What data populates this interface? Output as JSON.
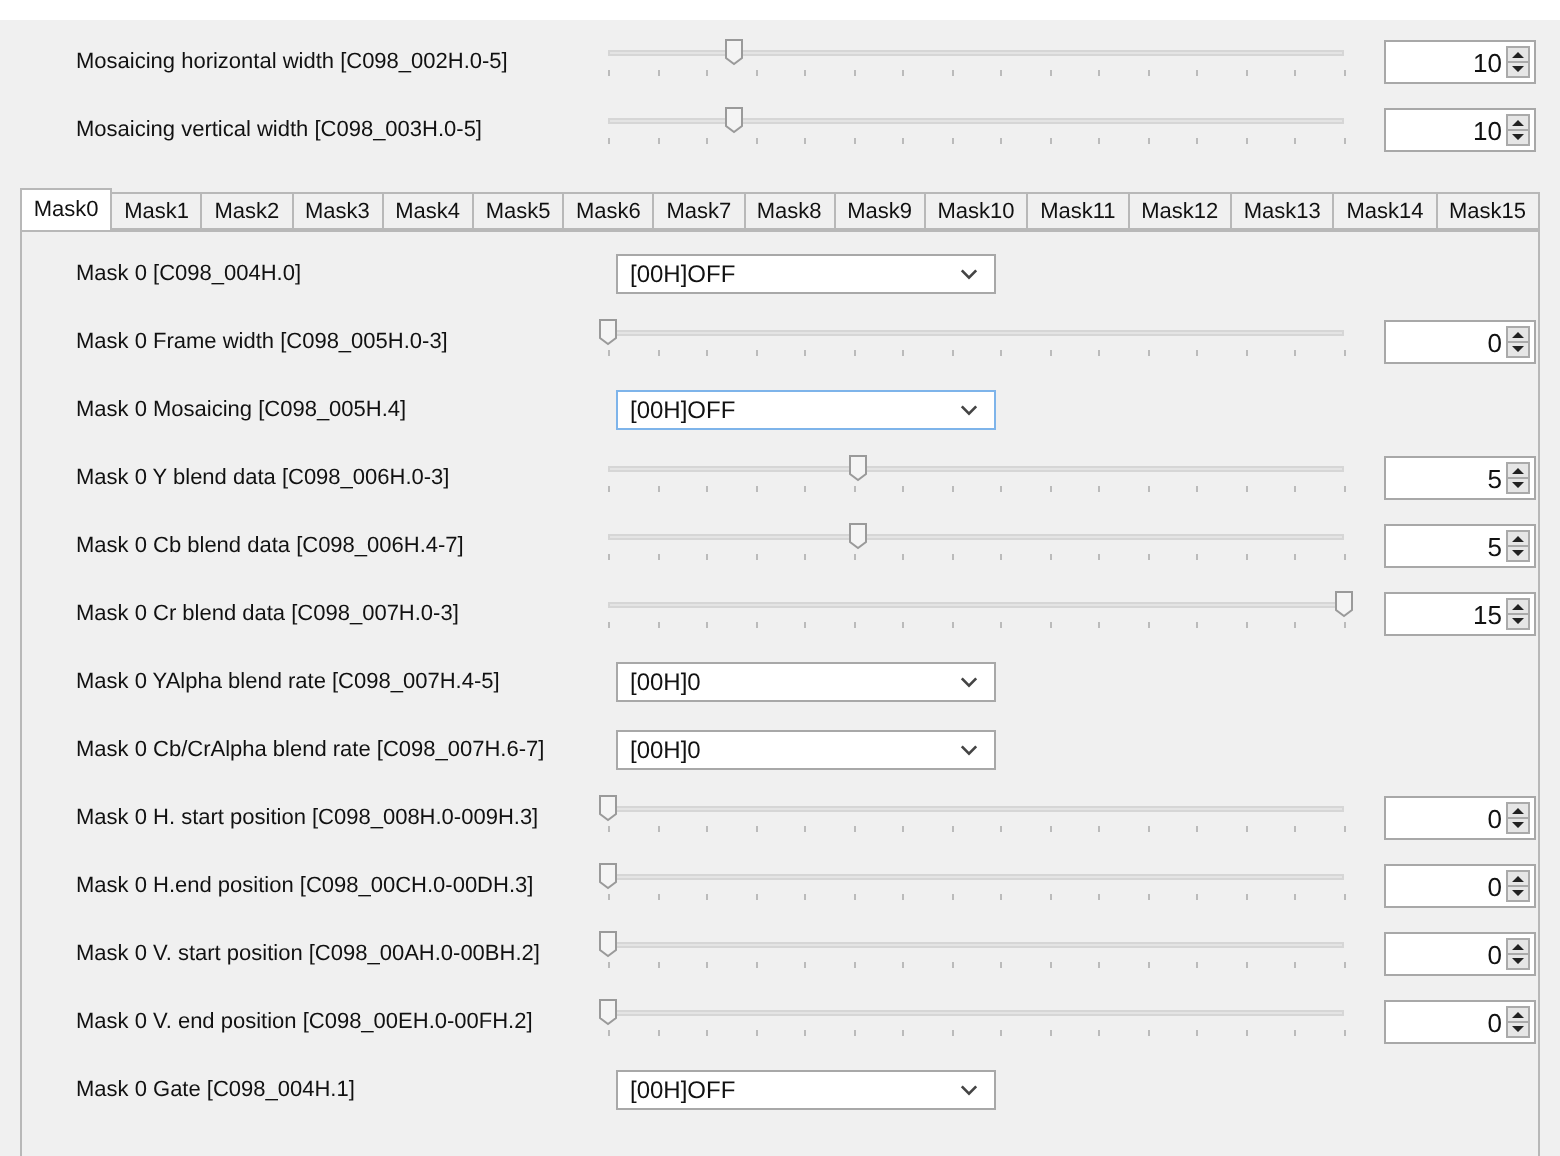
{
  "global_settings": [
    {
      "label": "Mosaicing horizontal width [C098_002H.0-5]",
      "level": 0.17,
      "value": "10"
    },
    {
      "label": "Mosaicing vertical width [C098_003H.0-5]",
      "level": 0.17,
      "value": "10"
    }
  ],
  "tabs": [
    {
      "label": "Mask0",
      "selected": true
    },
    {
      "label": "Mask1",
      "selected": false
    },
    {
      "label": "Mask2",
      "selected": false
    },
    {
      "label": "Mask3",
      "selected": false
    },
    {
      "label": "Mask4",
      "selected": false
    },
    {
      "label": "Mask5",
      "selected": false
    },
    {
      "label": "Mask6",
      "selected": false
    },
    {
      "label": "Mask7",
      "selected": false
    },
    {
      "label": "Mask8",
      "selected": false
    },
    {
      "label": "Mask9",
      "selected": false
    },
    {
      "label": "Mask10",
      "selected": false
    },
    {
      "label": "Mask11",
      "selected": false
    },
    {
      "label": "Mask12",
      "selected": false
    },
    {
      "label": "Mask13",
      "selected": false
    },
    {
      "label": "Mask14",
      "selected": false
    },
    {
      "label": "Mask15",
      "selected": false
    }
  ],
  "mask_settings": [
    {
      "kind": "combo",
      "label": "Mask 0 [C098_004H.0]",
      "value": "[00H]OFF",
      "focused": false
    },
    {
      "kind": "slider",
      "label": "Mask 0 Frame width [C098_005H.0-3]",
      "level": 0,
      "value": "0"
    },
    {
      "kind": "combo",
      "label": "Mask 0 Mosaicing [C098_005H.4]",
      "value": "[00H]OFF",
      "focused": true
    },
    {
      "kind": "slider",
      "label": "Mask 0 Y blend data [C098_006H.0-3]",
      "level": 0.34,
      "value": "5"
    },
    {
      "kind": "slider",
      "label": "Mask 0 Cb blend data [C098_006H.4-7]",
      "level": 0.34,
      "value": "5"
    },
    {
      "kind": "slider",
      "label": "Mask 0 Cr blend data [C098_007H.0-3]",
      "level": 1,
      "value": "15"
    },
    {
      "kind": "combo",
      "label": "Mask 0 YAlpha blend rate [C098_007H.4-5]",
      "value": "[00H]0",
      "focused": false
    },
    {
      "kind": "combo",
      "label": "Mask 0 Cb/CrAlpha blend rate [C098_007H.6-7]",
      "value": "[00H]0",
      "focused": false
    },
    {
      "kind": "slider",
      "label": "Mask 0 H. start position [C098_008H.0-009H.3]",
      "level": 0,
      "value": "0"
    },
    {
      "kind": "slider",
      "label": "Mask 0 H.end position [C098_00CH.0-00DH.3]",
      "level": 0,
      "value": "0"
    },
    {
      "kind": "slider",
      "label": "Mask 0 V. start position [C098_00AH.0-00BH.2]",
      "level": 0,
      "value": "0"
    },
    {
      "kind": "slider",
      "label": "Mask 0 V. end position [C098_00EH.0-00FH.2]",
      "level": 0,
      "value": "0"
    },
    {
      "kind": "combo",
      "label": "Mask 0 Gate [C098_004H.1]",
      "value": "[00H]OFF",
      "focused": false
    }
  ]
}
